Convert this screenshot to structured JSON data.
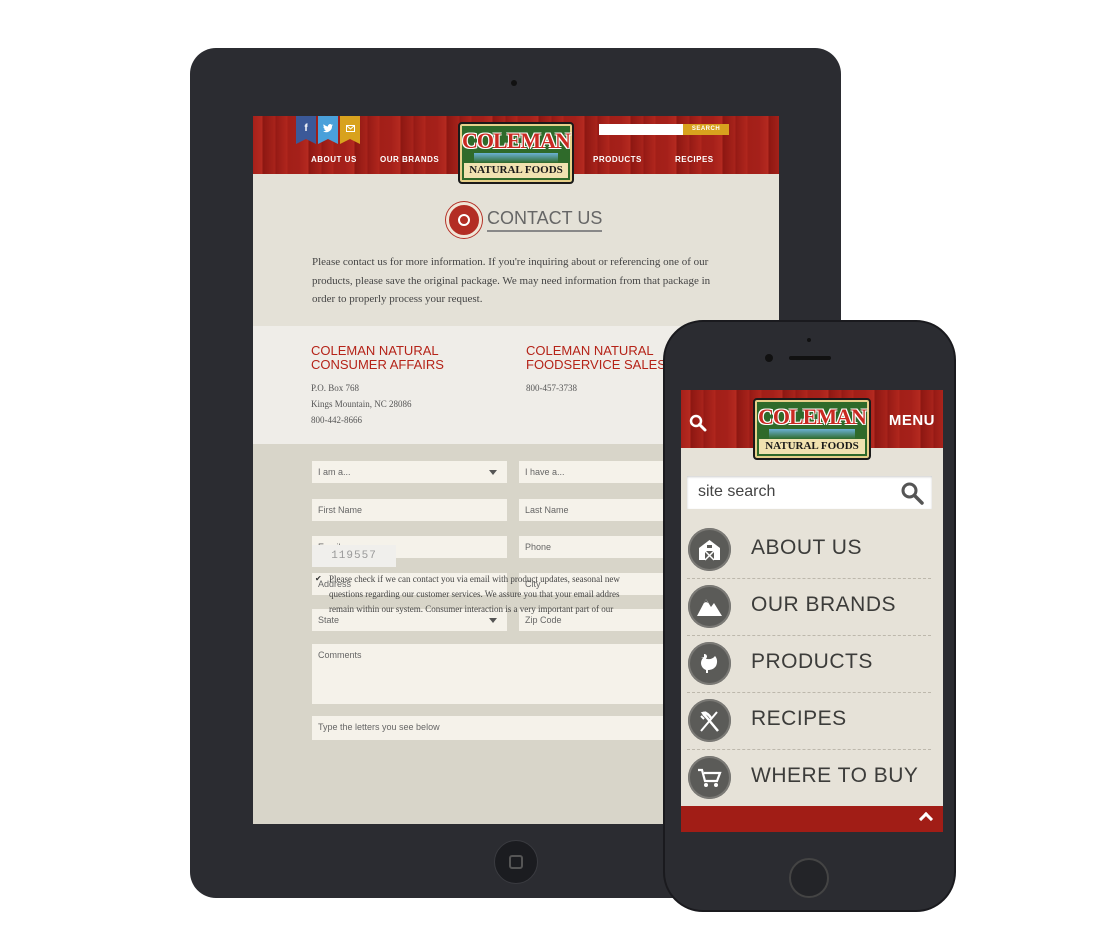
{
  "tablet": {
    "header": {
      "nav": [
        "ABOUT US",
        "OUR BRANDS",
        "PRODUCTS",
        "RECIPES"
      ],
      "search_button": "SEARCH",
      "logo_top": "COLEMAN",
      "logo_bottom": "NATURAL FOODS"
    },
    "title": "CONTACT US",
    "intro": "Please contact us for more information. If you're inquiring about or referencing one of our products, please save the original package. We may need information from that package in order to properly process your request.",
    "affairs": [
      {
        "title": "COLEMAN NATURAL\nCONSUMER AFFAIRS",
        "lines": [
          "P.O. Box 768",
          "Kings Mountain, NC 28086",
          "800-442-8666"
        ]
      },
      {
        "title": "COLEMAN NATURAL\nFOODSERVICE SALES",
        "lines": [
          "800-457-3738"
        ]
      }
    ],
    "form": {
      "i_am": "I am a...",
      "i_have": "I have a...",
      "first_name": "First Name",
      "last_name": "Last Name",
      "email": "Email",
      "phone": "Phone",
      "address": "Address",
      "city": "City",
      "state": "State",
      "zip": "Zip Code",
      "comments": "Comments",
      "captcha_prompt": "Type the letters you see below",
      "captcha_value": "119557",
      "consent_lines": [
        "Please check if we can contact you via email with product updates, seasonal new",
        "questions regarding our customer services. We assure you that your email addres",
        "remain within our system. Consumer interaction is a very important part of our"
      ]
    }
  },
  "phone": {
    "menu_label": "MENU",
    "logo_top": "COLEMAN",
    "logo_bottom": "NATURAL FOODS",
    "search_placeholder": "site search",
    "menu_items": [
      {
        "label": "ABOUT US",
        "icon": "barn-icon"
      },
      {
        "label": "OUR BRANDS",
        "icon": "mountains-icon"
      },
      {
        "label": "PRODUCTS",
        "icon": "chicken-icon"
      },
      {
        "label": "RECIPES",
        "icon": "fork-knife-icon"
      },
      {
        "label": "WHERE TO BUY",
        "icon": "cart-icon"
      }
    ],
    "colors": {
      "brand_red": "#a5201a",
      "gold": "#d8a21e",
      "icon_gray": "#5b5b58"
    }
  }
}
